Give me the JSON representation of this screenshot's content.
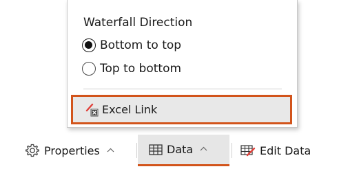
{
  "popup": {
    "section_title": "Waterfall Direction",
    "options": [
      {
        "label": "Bottom to top",
        "checked": true
      },
      {
        "label": "Top to bottom",
        "checked": false
      }
    ],
    "excel_link": {
      "label": "Excel Link",
      "icon": "excel-link-icon",
      "highlight_color": "#d2541b"
    }
  },
  "toolbar": {
    "properties": {
      "label": "Properties",
      "icon": "gear-icon",
      "chevron": "^"
    },
    "data": {
      "label": "Data",
      "icon": "table-icon",
      "chevron": "^",
      "active": true
    },
    "edit_data": {
      "label": "Edit Data",
      "icon": "edit-table-icon"
    }
  },
  "colors": {
    "accent": "#d2541b",
    "active_bg": "#e6e6e6"
  }
}
